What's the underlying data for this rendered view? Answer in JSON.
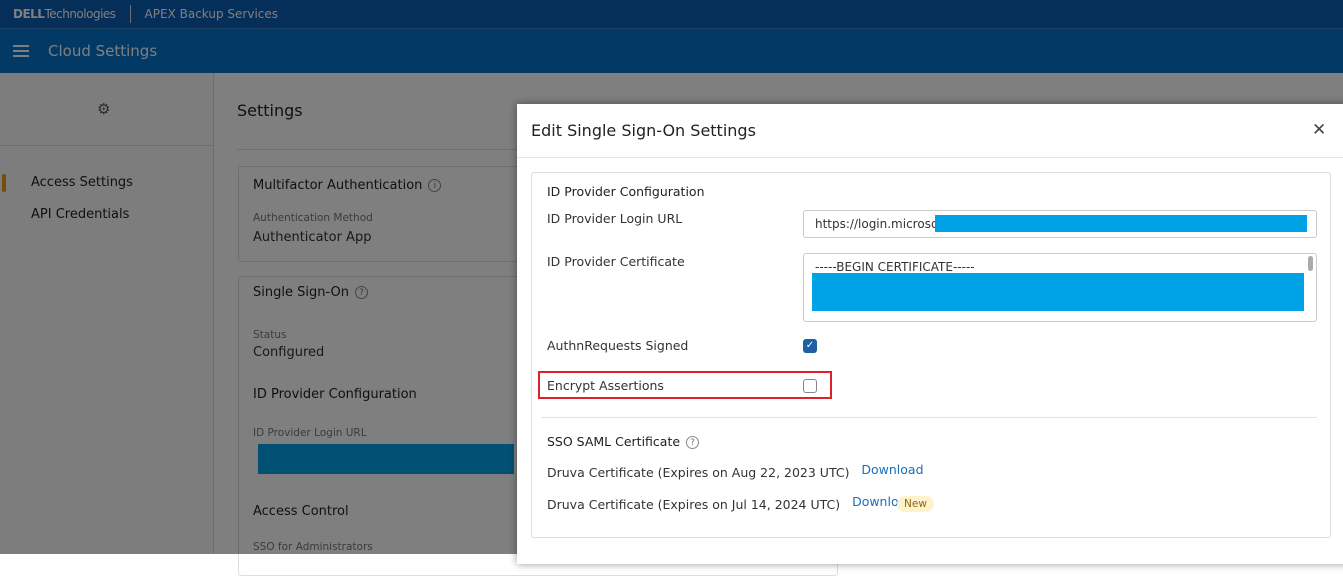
{
  "topbar": {
    "brand_bold": "DELL",
    "brand_rest": "Technologies",
    "product": "APEX Backup Services"
  },
  "navbar": {
    "title": "Cloud Settings"
  },
  "sidebar": {
    "items": [
      {
        "label": "Access Settings",
        "active": true
      },
      {
        "label": "API Credentials"
      }
    ]
  },
  "main": {
    "title": "Settings",
    "mfa": {
      "title": "Multifactor Authentication",
      "method_label": "Authentication Method",
      "method_value": "Authenticator App"
    },
    "sso": {
      "title": "Single Sign-On",
      "status_label": "Status",
      "status_value": "Configured",
      "idp_heading": "ID Provider Configuration",
      "login_url_label": "ID Provider Login URL",
      "access_heading": "Access Control",
      "sso_admin_label": "SSO for Administrators"
    }
  },
  "modal": {
    "title": "Edit Single Sign-On Settings",
    "section_title": "ID Provider Configuration",
    "login_url_label": "ID Provider Login URL",
    "login_url_value": "https://login.microso",
    "certificate_label": "ID Provider Certificate",
    "certificate_value": "-----BEGIN CERTIFICATE-----",
    "authn_label": "AuthnRequests Signed",
    "authn_checked": true,
    "encrypt_label": "Encrypt Assertions",
    "encrypt_checked": false,
    "saml_title": "SSO SAML Certificate",
    "certs": [
      {
        "label": "Druva Certificate (Expires on Aug 22, 2023 UTC)",
        "action": "Download"
      },
      {
        "label": "Druva Certificate (Expires on Jul 14, 2024 UTC)",
        "action": "Download",
        "badge": "New"
      }
    ],
    "colors": {
      "accent": "#1a6fbf",
      "checkbox": "#1f5fa8",
      "highlight": "#e0202a",
      "redaction": "#00a2e6"
    }
  }
}
